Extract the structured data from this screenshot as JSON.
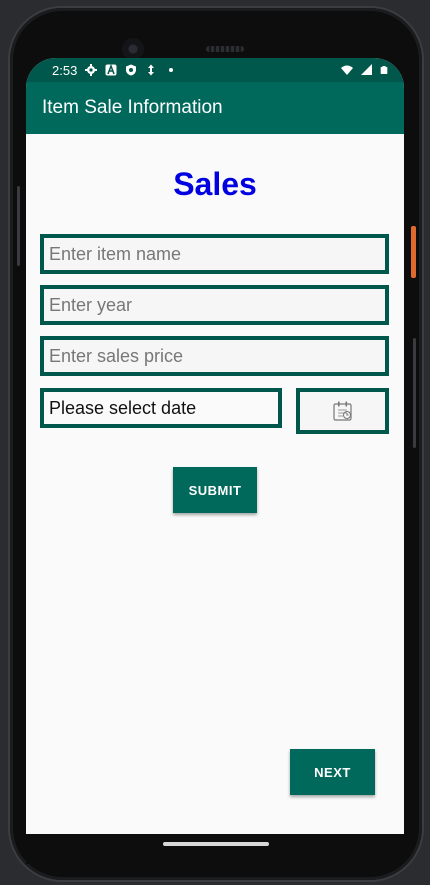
{
  "status": {
    "time": "2:53",
    "icons_left": [
      "gear-icon",
      "a-icon",
      "shield-icon",
      "lightning-icon",
      "dot-icon"
    ],
    "icons_right": [
      "wifi-icon",
      "signal-icon",
      "battery-icon"
    ]
  },
  "appbar": {
    "title": "Item Sale Information"
  },
  "form": {
    "heading": "Sales",
    "item_name_placeholder": "Enter item name",
    "year_placeholder": "Enter year",
    "price_placeholder": "Enter sales price",
    "date_text": "Please select date",
    "date_picker_icon": "calendar-icon"
  },
  "buttons": {
    "submit_label": "SUBMIT",
    "next_label": "NEXT"
  },
  "colors": {
    "primary": "#00695c",
    "primary_dark": "#00574b",
    "heading": "#0000e0"
  }
}
